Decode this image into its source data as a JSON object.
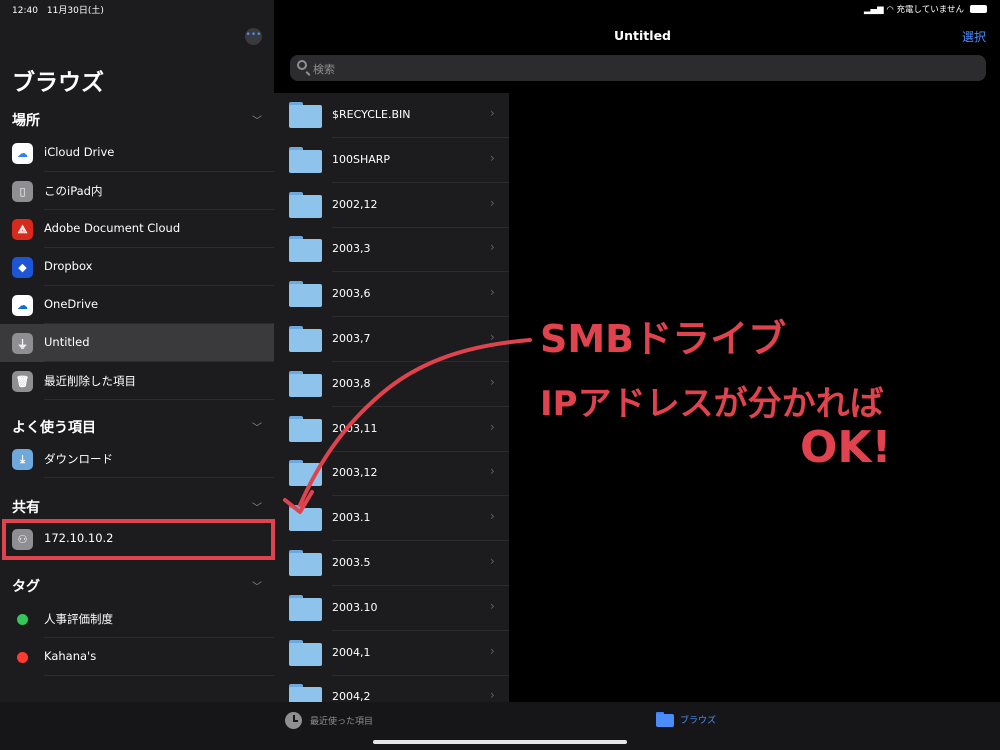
{
  "status": {
    "time_date": "12:40　11月30日(土)",
    "charging": "充電していません"
  },
  "sidebar": {
    "more_label": "•••",
    "title": "ブラウズ",
    "locations_header": "場所",
    "locations": [
      {
        "label": "iCloud Drive",
        "icon": "icloud-icon",
        "color": "#ffffff"
      },
      {
        "label": "このiPad内",
        "icon": "ipad-icon",
        "color": "#8e8e93"
      },
      {
        "label": "Adobe Document Cloud",
        "icon": "adobe-icon",
        "color": "#d7291c"
      },
      {
        "label": "Dropbox",
        "icon": "dropbox-icon",
        "color": "#1c56d6"
      },
      {
        "label": "OneDrive",
        "icon": "onedrive-icon",
        "color": "#ffffff"
      },
      {
        "label": "Untitled",
        "icon": "usb-drive-icon",
        "color": "#8e8e93",
        "selected": true
      },
      {
        "label": "最近削除した項目",
        "icon": "trash-icon",
        "color": "#8e8e93"
      }
    ],
    "favorites_header": "よく使う項目",
    "favorites": [
      {
        "label": "ダウンロード",
        "icon": "downloads-folder-icon"
      }
    ],
    "shared_header": "共有",
    "shared": [
      {
        "label": "172.10.10.2",
        "icon": "server-icon"
      }
    ],
    "tags_header": "タグ",
    "tags": [
      {
        "label": "人事評価制度",
        "color": "#34c759"
      },
      {
        "label": "Kahana's",
        "color": "#ff3b30"
      }
    ]
  },
  "nav": {
    "title": "Untitled",
    "select_label": "選択",
    "search_placeholder": "検索"
  },
  "folders": [
    "$RECYCLE.BIN",
    "100SHARP",
    "2002,12",
    "2003,3",
    "2003,6",
    "2003,7",
    "2003,8",
    "2003,11",
    "2003,12",
    "2003.1",
    "2003.5",
    "2003.10",
    "2004,1",
    "2004,2"
  ],
  "tabbar": {
    "recents_label": "最近使った項目",
    "browse_label": "ブラウズ"
  },
  "annotation": {
    "line1": "SMBドライブ",
    "line2": "IPアドレスが分かれば",
    "line3": "OK!",
    "color": "#e0434e"
  }
}
